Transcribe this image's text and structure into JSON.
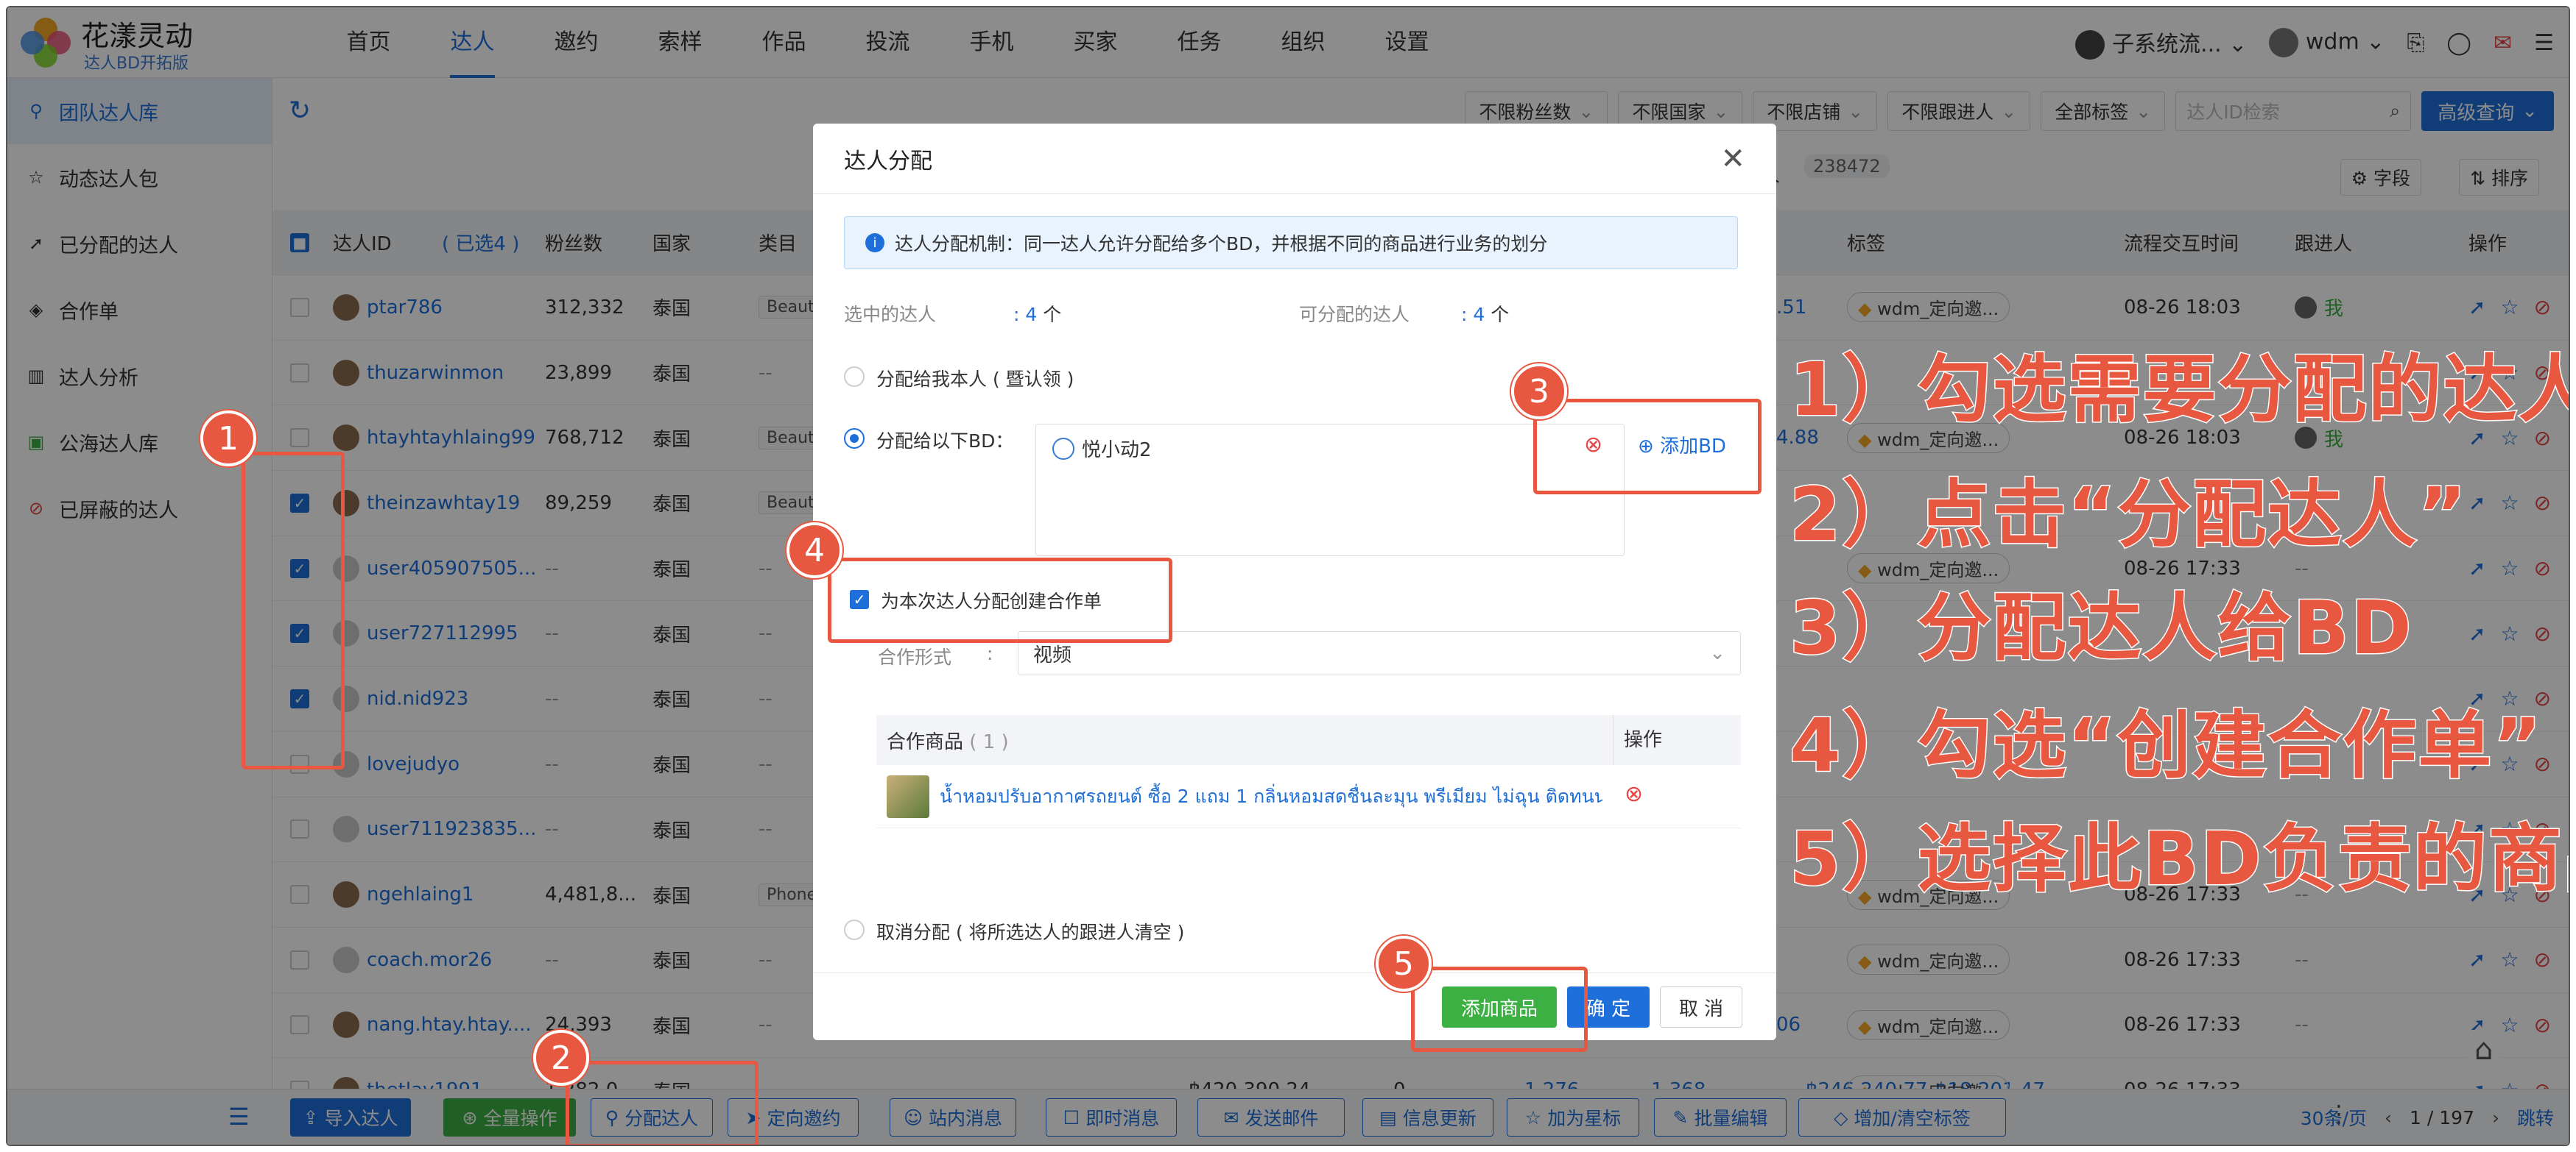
{
  "app": {
    "brand": "花漾灵动",
    "brand_sub": "达人BD开拓版"
  },
  "nav": {
    "items": [
      "首页",
      "达人",
      "邀约",
      "索样",
      "作品",
      "投流",
      "手机",
      "买家",
      "任务",
      "组织",
      "设置"
    ],
    "active": "达人",
    "team": "子系统流...",
    "user": "wdm"
  },
  "sidebar": {
    "items": [
      {
        "label": "团队达人库",
        "icon": "users-icon"
      },
      {
        "label": "动态达人包",
        "icon": "star-icon"
      },
      {
        "label": "已分配的达人",
        "icon": "assign-icon"
      },
      {
        "label": "合作单",
        "icon": "handshake-icon"
      },
      {
        "label": "达人分析",
        "icon": "chart-icon"
      },
      {
        "label": "公海达人库",
        "icon": "sea-icon"
      },
      {
        "label": "已屏蔽的达人",
        "icon": "block-icon"
      }
    ]
  },
  "toolbar": {
    "filters": [
      "不限粉丝数",
      "不限国家",
      "不限店铺",
      "不限跟进人",
      "全部标签"
    ],
    "search_placeholder": "达人ID检索",
    "advanced": "高级查询",
    "total_label": "人",
    "total": "238472",
    "fields": "字段",
    "sort": "排序"
  },
  "table": {
    "headers": {
      "id": "达人ID",
      "selected": "( 已选4 )",
      "fans": "粉丝数",
      "country": "国家",
      "category": "类目",
      "tag": "标签",
      "time": "流程交互时间",
      "follower": "跟进人",
      "ops": "操作"
    },
    "rows": [
      {
        "id": "ptar786",
        "fans": "312,332",
        "country": "泰国",
        "cat": "Beauty",
        "num": ".51",
        "tag": "wdm_定向邀...",
        "time": "08-26 18:03",
        "follower": "我",
        "checked": false
      },
      {
        "id": "thuzarwinmon",
        "fans": "23,899",
        "country": "泰国",
        "cat": "--",
        "num": "",
        "tag": "",
        "time": "",
        "follower": "",
        "checked": false
      },
      {
        "id": "htayhtayhlaing99",
        "fans": "768,712",
        "country": "泰国",
        "cat": "Beauty",
        "num": "4.88",
        "tag": "wdm_定向邀...",
        "time": "08-26 18:03",
        "follower": "我",
        "checked": false
      },
      {
        "id": "theinzawhtay19",
        "fans": "89,259",
        "country": "泰国",
        "cat": "Beauty",
        "num": "",
        "tag": "",
        "time": "",
        "follower": "",
        "checked": true
      },
      {
        "id": "user405907505...",
        "fans": "--",
        "country": "泰国",
        "cat": "--",
        "num": "",
        "tag": "wdm_定向邀...",
        "time": "08-26 17:33",
        "follower": "--",
        "checked": true
      },
      {
        "id": "user727112995",
        "fans": "--",
        "country": "泰国",
        "cat": "--",
        "num": "",
        "tag": "",
        "time": "",
        "follower": "",
        "checked": true
      },
      {
        "id": "nid.nid923",
        "fans": "--",
        "country": "泰国",
        "cat": "--",
        "num": "",
        "tag": "",
        "time": "",
        "follower": "",
        "checked": true
      },
      {
        "id": "lovejudyo",
        "fans": "--",
        "country": "泰国",
        "cat": "--",
        "num": "",
        "tag": "",
        "time": "",
        "follower": "",
        "checked": false
      },
      {
        "id": "user711923835...",
        "fans": "--",
        "country": "泰国",
        "cat": "--",
        "num": "",
        "tag": "",
        "time": "",
        "follower": "",
        "checked": false
      },
      {
        "id": "ngehlaing1",
        "fans": "4,481,8...",
        "country": "泰国",
        "cat": "Phones",
        "num": "",
        "tag": "wdm_定向邀...",
        "time": "08-26 17:33",
        "follower": "--",
        "checked": false
      },
      {
        "id": "coach.mor26",
        "fans": "--",
        "country": "泰国",
        "cat": "--",
        "num": "",
        "tag": "wdm_定向邀...",
        "time": "08-26 17:33",
        "follower": "--",
        "checked": false
      },
      {
        "id": "nang.htay.htay....",
        "fans": "24,393",
        "country": "泰国",
        "cat": "--",
        "num": "06",
        "tag": "wdm_定向邀...",
        "time": "08-26 17:33",
        "follower": "--",
        "checked": false
      },
      {
        "id": "thetlay1991",
        "fans": "1,282,0...",
        "country": "泰国",
        "cat": "--",
        "gmv": "฿420,390.24",
        "z": "0",
        "a": "1,276",
        "b": "1,368",
        "c": "฿246,240.77",
        "num": "฿18,201.47",
        "tag": "wdm_定向邀...",
        "time": "08-26 17:33",
        "follower": "--",
        "checked": false
      }
    ]
  },
  "bottom": {
    "buttons": [
      "导入达人",
      "全量操作",
      "分配达人",
      "定向邀约",
      "站内消息",
      "即时消息",
      "发送邮件",
      "信息更新",
      "加为星标",
      "批量编辑",
      "增加/清空标签"
    ],
    "page_size": "30条/页",
    "page": "1 / 197",
    "jump": "跳转"
  },
  "modal": {
    "title": "达人分配",
    "info": "达人分配机制：同一达人允许分配给多个BD，并根据不同的商品进行业务的划分",
    "selected_label": "选中的达人",
    "selected_val": "4",
    "assignable_label": "可分配的达人",
    "assignable_val": "4",
    "unit": "个",
    "opt_self": "分配给我本人 ( 暨认领 )",
    "opt_bd": "分配给以下BD：",
    "bd_name": "悦小动2",
    "add_bd": "添加BD",
    "create_order": "为本次达人分配创建合作单",
    "coop_form_label": "合作形式",
    "coop_form_val": "视频",
    "products_header": "合作商品",
    "products_count": "( 1 )",
    "ops_header": "操作",
    "product_name": "น้ำหอมปรับอากาศรถยนต์ ซื้อ 2 แถม 1 กลิ่นหอมสดชื่นละมุน พรีเมียม ไม่ฉุน ติดทนนาน...",
    "opt_cancel": "取消分配 ( 将所选达人的跟进人清空 )",
    "btn_add_product": "添加商品",
    "btn_ok": "确 定",
    "btn_cancel": "取 消"
  },
  "annotations": {
    "steps": [
      "1）勾选需要分配的达人",
      "2）点击“分配达人”",
      "3）分配达人给BD",
      "4）勾选“创建合作单”",
      "5）选择此BD负责的商品"
    ],
    "badges": [
      "1",
      "2",
      "3",
      "4",
      "5"
    ],
    "color": "#e8573f"
  },
  "colors": {
    "primary": "#1e6fd9",
    "green": "#3cb043",
    "danger": "#e54545"
  }
}
